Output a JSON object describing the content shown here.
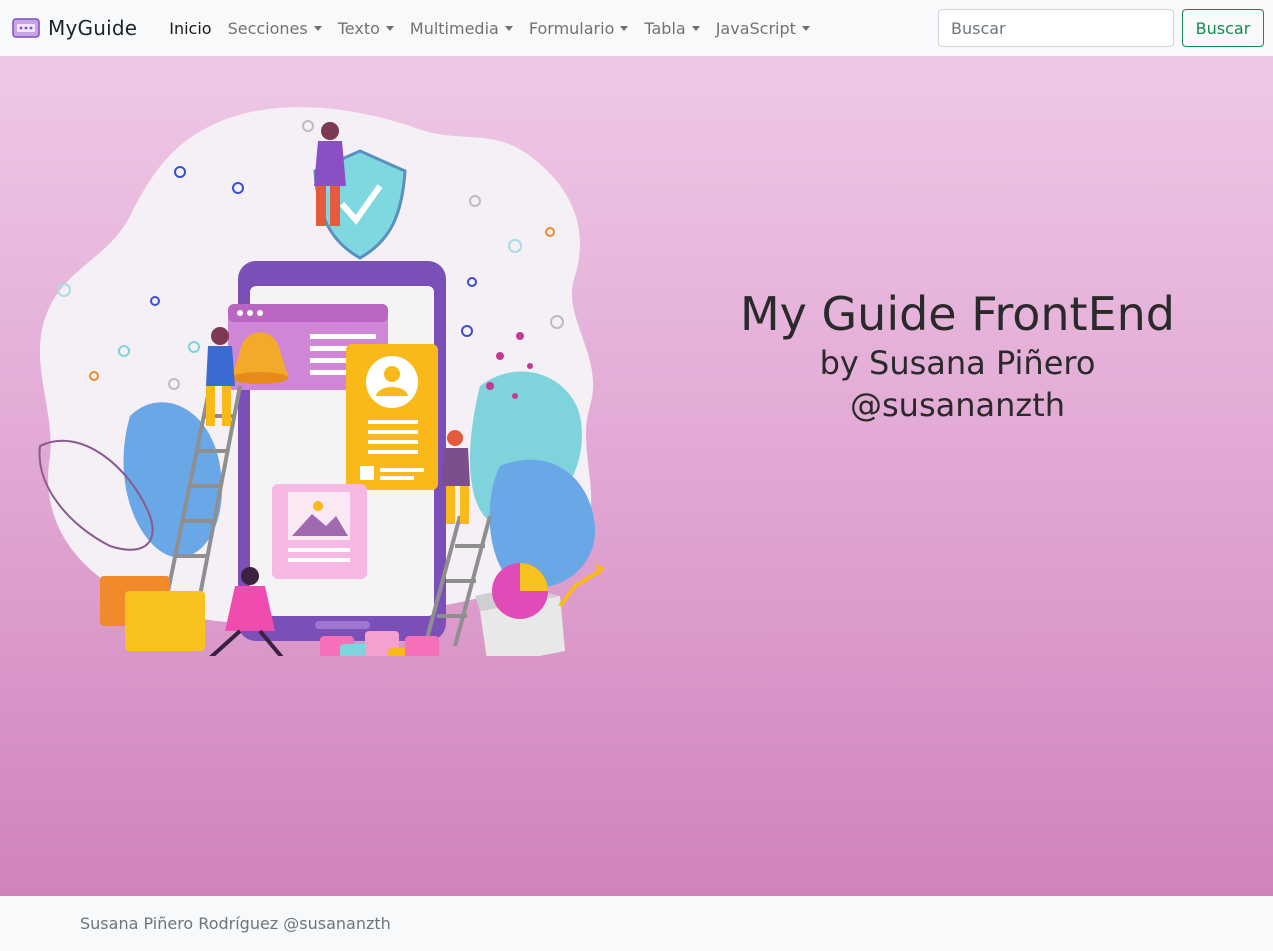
{
  "brand": {
    "name": "MyGuide",
    "icon": "screen-icon"
  },
  "nav": {
    "items": [
      {
        "label": "Inicio",
        "active": true,
        "dropdown": false
      },
      {
        "label": "Secciones",
        "active": false,
        "dropdown": true
      },
      {
        "label": "Texto",
        "active": false,
        "dropdown": true
      },
      {
        "label": "Multimedia",
        "active": false,
        "dropdown": true
      },
      {
        "label": "Formulario",
        "active": false,
        "dropdown": true
      },
      {
        "label": "Tabla",
        "active": false,
        "dropdown": true
      },
      {
        "label": "JavaScript",
        "active": false,
        "dropdown": true
      }
    ]
  },
  "search": {
    "placeholder": "Buscar",
    "button_label": "Buscar"
  },
  "hero": {
    "title": "My Guide FrontEnd",
    "subtitle": "by Susana Piñero",
    "handle": "@susananzth"
  },
  "footer": {
    "text": "Susana Piñero Rodríguez @susananzth"
  },
  "colors": {
    "button_accent": "#198754",
    "hero_top": "#efc8e6",
    "hero_bottom": "#cf83bb"
  }
}
